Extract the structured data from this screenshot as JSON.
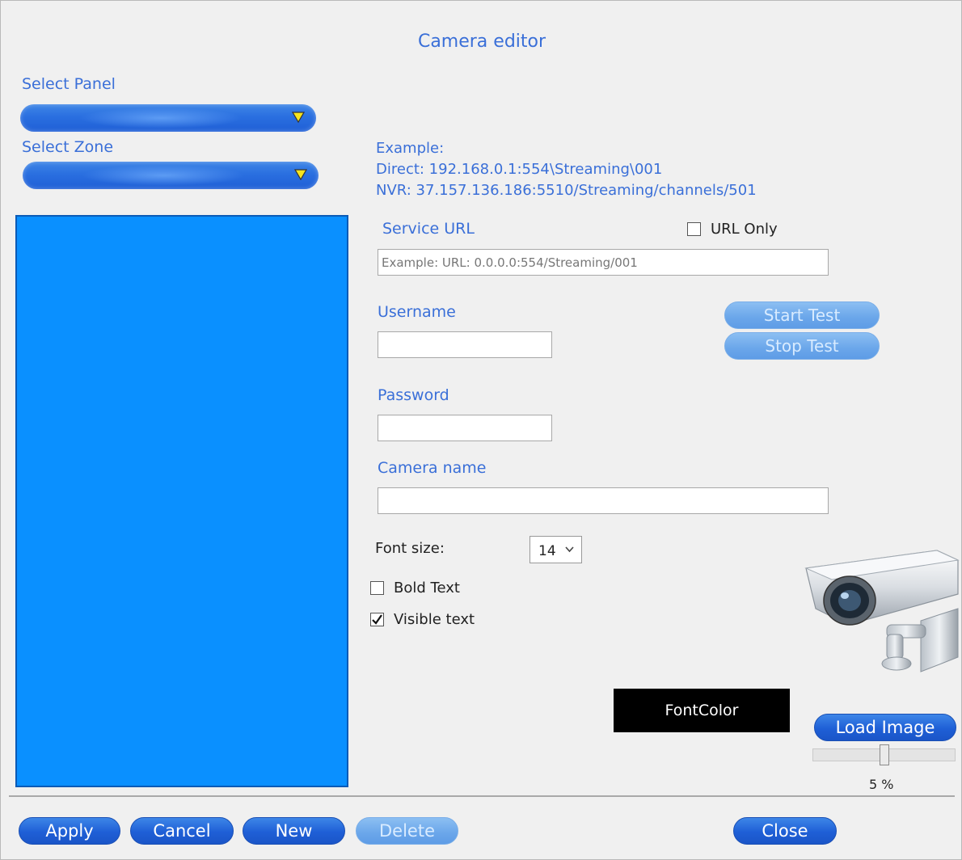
{
  "window": {
    "title": "Camera editor"
  },
  "panel": {
    "label": "Select Panel",
    "value": ""
  },
  "zone": {
    "label": "Select Zone",
    "value": ""
  },
  "example": {
    "heading": "Example:",
    "direct": "Direct: 192.168.0.1:554\\Streaming\\001",
    "nvr": "NVR: 37.157.136.186:5510/Streaming/channels/501"
  },
  "service_url": {
    "label": "Service URL",
    "placeholder": "Example: URL: 0.0.0.0:554/Streaming/001",
    "value": ""
  },
  "url_only": {
    "label": "URL Only",
    "checked": false
  },
  "username": {
    "label": "Username",
    "value": ""
  },
  "password": {
    "label": "Password",
    "value": ""
  },
  "camera_name": {
    "label": "Camera name",
    "value": ""
  },
  "test_buttons": {
    "start": "Start Test",
    "stop": "Stop Test"
  },
  "font": {
    "size_label": "Font size:",
    "size_value": "14",
    "bold_label": "Bold Text",
    "bold_checked": false,
    "visible_label": "Visible text",
    "visible_checked": true,
    "color_button": "FontColor",
    "color_value": "#000000"
  },
  "image": {
    "load_label": "Load Image",
    "zoom_percent": 5,
    "zoom_text": "5 %",
    "icon": "security-camera-icon"
  },
  "footer": {
    "apply": "Apply",
    "cancel": "Cancel",
    "new": "New",
    "delete": "Delete",
    "close": "Close"
  },
  "colors": {
    "accent": "#3a6fd8",
    "list_background": "#0a90ff",
    "button_blue": "#1f5fd6",
    "arrow_yellow": "#f6e51e"
  }
}
